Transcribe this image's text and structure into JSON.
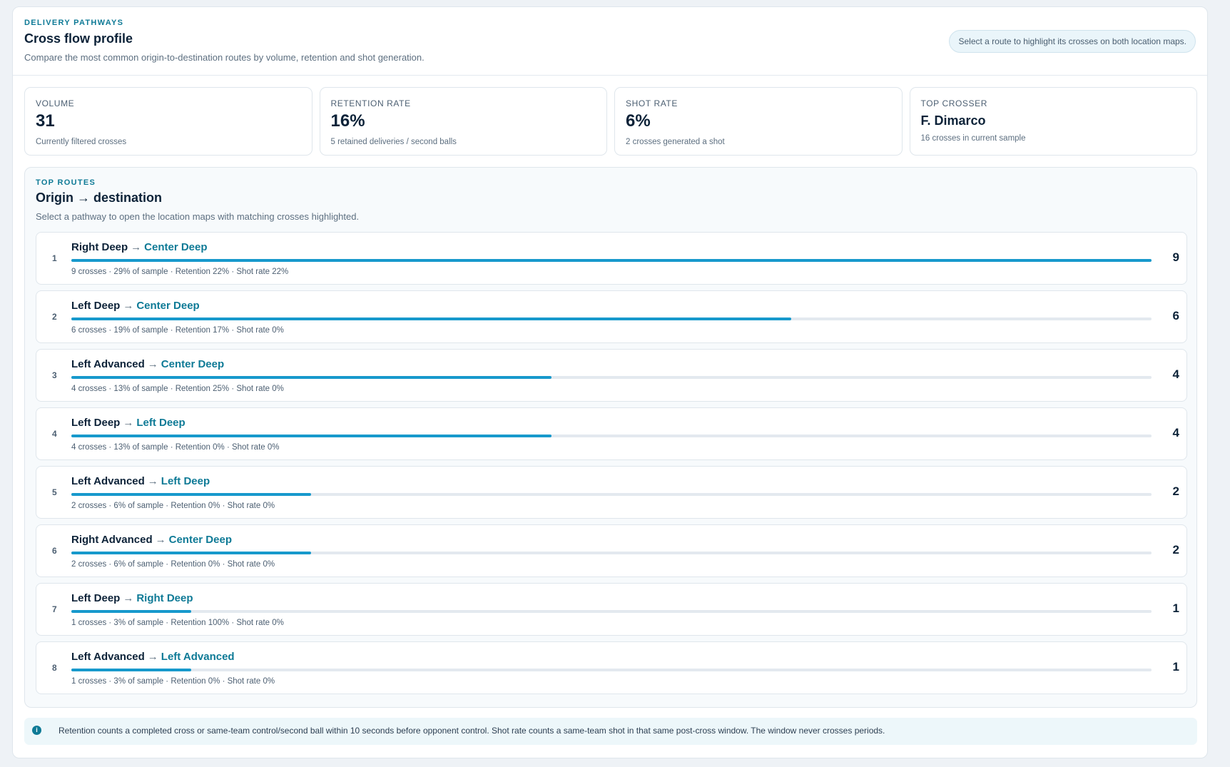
{
  "header": {
    "eyebrow": "DELIVERY PATHWAYS",
    "title": "Cross flow profile",
    "subtitle": "Compare the most common origin-to-destination routes by volume, retention and shot generation.",
    "hint": "Select a route to highlight its crosses on both location maps."
  },
  "stats": [
    {
      "label": "VOLUME",
      "value": "31",
      "desc": "Currently filtered crosses"
    },
    {
      "label": "RETENTION RATE",
      "value": "16%",
      "desc": "5 retained deliveries / second balls"
    },
    {
      "label": "SHOT RATE",
      "value": "6%",
      "desc": "2 crosses generated a shot"
    },
    {
      "label": "TOP CROSSER",
      "value": "F. Dimarco",
      "desc": "16 crosses in current sample"
    }
  ],
  "routes": {
    "eyebrow": "TOP ROUTES",
    "title": "Origin → destination",
    "desc": "Select a pathway to open the location maps with matching crosses highlighted.",
    "arrow": "→",
    "max_count": 9,
    "items": [
      {
        "rank": "1",
        "origin": "Right Deep",
        "dest": "Center Deep",
        "count": 9,
        "meta": "9 crosses · 29% of sample · Retention 22% · Shot rate 22%"
      },
      {
        "rank": "2",
        "origin": "Left Deep",
        "dest": "Center Deep",
        "count": 6,
        "meta": "6 crosses · 19% of sample · Retention 17% · Shot rate 0%"
      },
      {
        "rank": "3",
        "origin": "Left Advanced",
        "dest": "Center Deep",
        "count": 4,
        "meta": "4 crosses · 13% of sample · Retention 25% · Shot rate 0%"
      },
      {
        "rank": "4",
        "origin": "Left Deep",
        "dest": "Left Deep",
        "count": 4,
        "meta": "4 crosses · 13% of sample · Retention 0% · Shot rate 0%"
      },
      {
        "rank": "5",
        "origin": "Left Advanced",
        "dest": "Left Deep",
        "count": 2,
        "meta": "2 crosses · 6% of sample · Retention 0% · Shot rate 0%"
      },
      {
        "rank": "6",
        "origin": "Right Advanced",
        "dest": "Center Deep",
        "count": 2,
        "meta": "2 crosses · 6% of sample · Retention 0% · Shot rate 0%"
      },
      {
        "rank": "7",
        "origin": "Left Deep",
        "dest": "Right Deep",
        "count": 1,
        "meta": "1 crosses · 3% of sample · Retention 100% · Shot rate 0%"
      },
      {
        "rank": "8",
        "origin": "Left Advanced",
        "dest": "Left Advanced",
        "count": 1,
        "meta": "1 crosses · 3% of sample · Retention 0% · Shot rate 0%"
      }
    ]
  },
  "note": {
    "icon": "info-icon",
    "text": "Retention counts a completed cross or same-team control/second ball within 10 seconds before opponent control. Shot rate counts a same-team shot in that same post-cross window. The window never crosses periods."
  },
  "colors": {
    "accent": "#0e7a96",
    "bar": "#1799cc",
    "track": "#e3e9ef"
  }
}
